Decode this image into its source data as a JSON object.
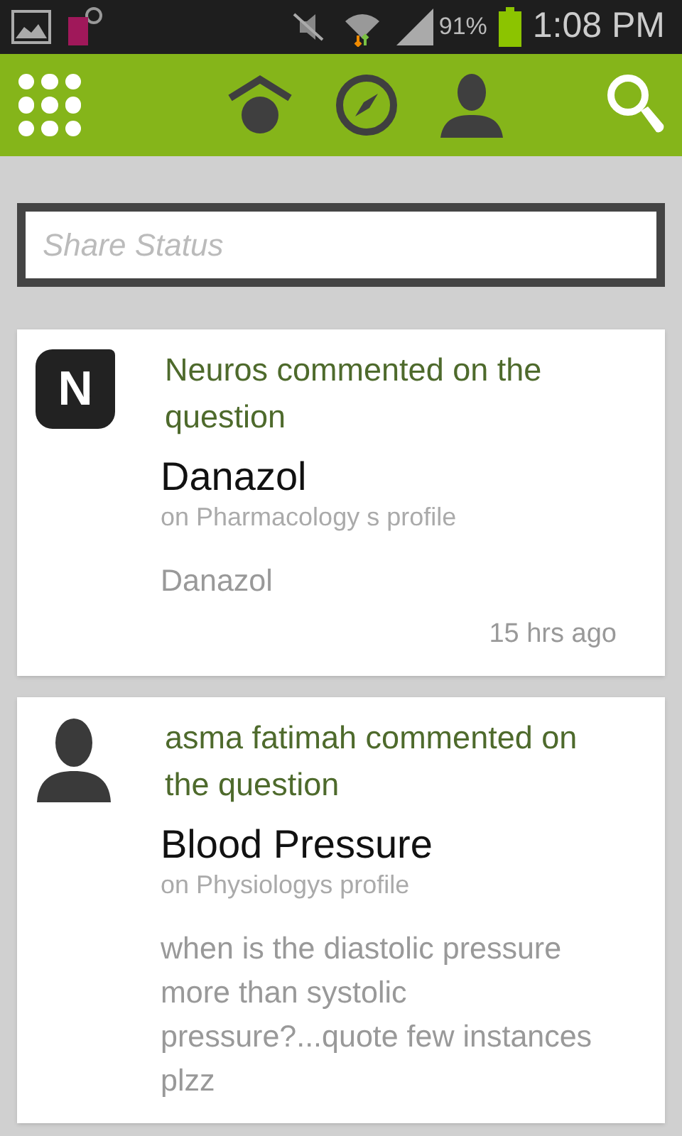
{
  "status_bar": {
    "battery": "91%",
    "time": "1:08 PM"
  },
  "search": {
    "placeholder": "Share Status"
  },
  "feed": [
    {
      "avatar": {
        "kind": "logo",
        "letter": "N"
      },
      "headline": "Neuros commented on the question",
      "title": "Danazol",
      "profile": "on Pharmacology s profile",
      "body": "Danazol",
      "time": "15 hrs ago"
    },
    {
      "avatar": {
        "kind": "silhouette"
      },
      "headline": "asma fatimah commented on the question",
      "title": "Blood Pressure",
      "profile": "on Physiologys profile",
      "body": "when is the diastolic pressure more than systolic pressure?...quote few instances plzz"
    }
  ]
}
